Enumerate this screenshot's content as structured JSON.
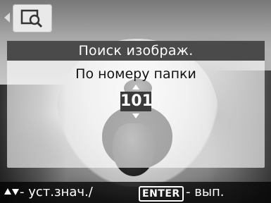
{
  "topbar": {
    "mode_icon": "image-search-icon",
    "nav_icon": "arrow-left-icon"
  },
  "dialog": {
    "title": "Поиск изображ.",
    "subtitle": "По номеру папки",
    "folder_number": "101"
  },
  "helpbar": {
    "arrows_icon": "up-down-arrows-icon",
    "text_set_value": " - уст.знач./",
    "enter_key": "ENTER",
    "text_execute": " - вып."
  }
}
